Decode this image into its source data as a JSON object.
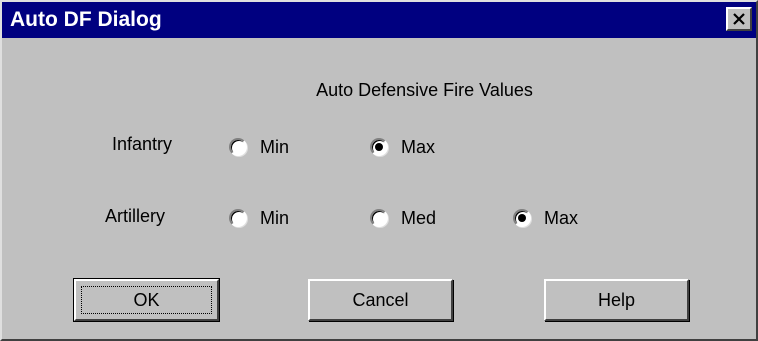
{
  "window": {
    "title": "Auto DF Dialog"
  },
  "heading": "Auto Defensive Fire Values",
  "infantry": {
    "label": "Infantry",
    "options": [
      {
        "label": "Min",
        "selected": false
      },
      {
        "label": "Max",
        "selected": true
      }
    ]
  },
  "artillery": {
    "label": "Artillery",
    "options": [
      {
        "label": "Min",
        "selected": false
      },
      {
        "label": "Med",
        "selected": false
      },
      {
        "label": "Max",
        "selected": true
      }
    ]
  },
  "buttons": {
    "ok": "OK",
    "cancel": "Cancel",
    "help": "Help"
  },
  "colors": {
    "face": "#c0c0c0",
    "titlebar": "#000080"
  }
}
